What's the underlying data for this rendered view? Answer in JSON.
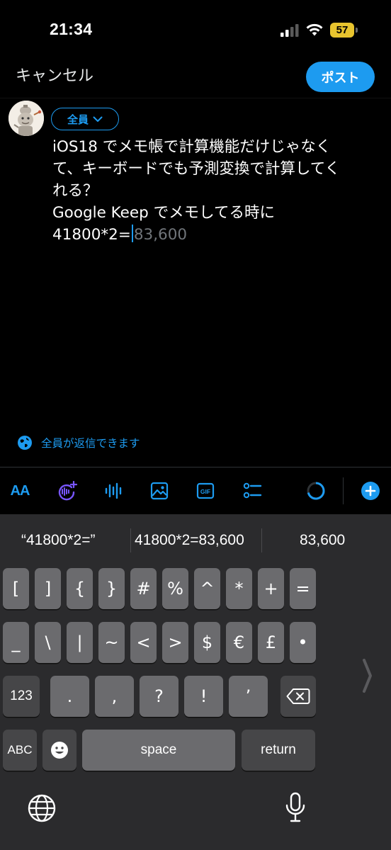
{
  "status_bar": {
    "time": "21:34",
    "battery": "57"
  },
  "nav": {
    "cancel_label": "キャンセル",
    "post_label": "ポスト"
  },
  "compose": {
    "audience_label": "全員",
    "text_lines": [
      "iOS18 でメモ帳で計算機能だけじゃなく",
      "て、キーボードでも予測変換で計算してく",
      "れる？",
      "Google Keep でメモしてる時に"
    ],
    "typed_text": "41800*2=",
    "suggestion_text": "83,600",
    "reply_setting_label": "全員が返信できます"
  },
  "toolbar": {
    "text_style_icon": "AA",
    "gif_label": "GIF",
    "icons": [
      "text-style-icon",
      "grok-icon",
      "voice-icon",
      "image-icon",
      "gif-icon",
      "poll-icon",
      "char-count-ring-icon",
      "add-post-icon"
    ]
  },
  "keyboard": {
    "predictions": [
      "“41800*2=”",
      "41800*2=83,600",
      "83,600"
    ],
    "row1": [
      "[",
      "]",
      "{",
      "}",
      "#",
      "%",
      "^",
      "*",
      "+",
      "="
    ],
    "row2": [
      "_",
      "\\",
      "|",
      "~",
      "<",
      ">",
      "$",
      "€",
      "£",
      "•"
    ],
    "row3": [
      ".",
      ",",
      "?",
      "!",
      "’"
    ],
    "numbers_label": "123",
    "abc_label": "ABC",
    "space_label": "space",
    "return_label": "return"
  },
  "colors": {
    "accent": "#1d9bf0",
    "grok_purple": "#7856ff",
    "battery_yellow": "#e8c42e",
    "key_gray": "#6b6b6e",
    "key_dark": "#464648",
    "keyboard_bg": "#2b2b2d"
  }
}
